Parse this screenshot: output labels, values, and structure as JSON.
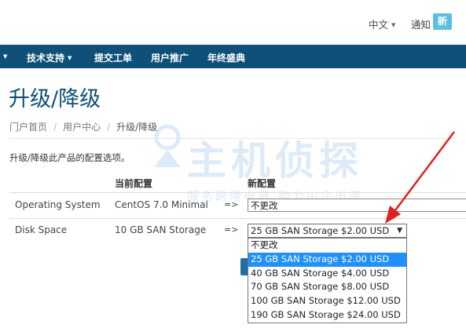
{
  "header": {
    "language": "中文",
    "notifications": "通知",
    "notify_badge": "新"
  },
  "nav": {
    "items": [
      {
        "label": "技术支持",
        "has_dropdown": true
      },
      {
        "label": "提交工单"
      },
      {
        "label": "用户推广"
      },
      {
        "label": "年终盛典"
      }
    ]
  },
  "page": {
    "title": "升级/降级",
    "breadcrumb": [
      "门户首页",
      "用户中心",
      "升级/降级"
    ],
    "intro": "升级/降级此产品的配置选项。"
  },
  "table": {
    "headers": {
      "current": "当前配置",
      "new": "新配置"
    },
    "arrow": "=>",
    "rows": [
      {
        "name": "Operating System",
        "current": "CentOS 7.0 Minimal",
        "selected": "不更改"
      },
      {
        "name": "Disk Space",
        "current": "10 GB SAN Storage",
        "selected": "25 GB SAN Storage $2.00 USD"
      }
    ]
  },
  "dropdown": {
    "options": [
      "不更改",
      "25 GB SAN Storage $2.00 USD",
      "40 GB SAN Storage $4.00 USD",
      "70 GB SAN Storage $8.00 USD",
      "100 GB SAN Storage $12.00 USD",
      "190 GB SAN Storage $24.00 USD"
    ],
    "highlighted_index": 1
  },
  "watermark": {
    "main": "主机侦探",
    "slogan": "服务跨境电商 助力中企出海"
  },
  "colors": {
    "brand": "#0e5077",
    "badge": "#5bc0de",
    "highlight": "#1e90ff",
    "annotation": "#e02020"
  },
  "icons": {
    "dropdown": "chevron-down-icon",
    "annotation": "red-arrow-icon"
  }
}
